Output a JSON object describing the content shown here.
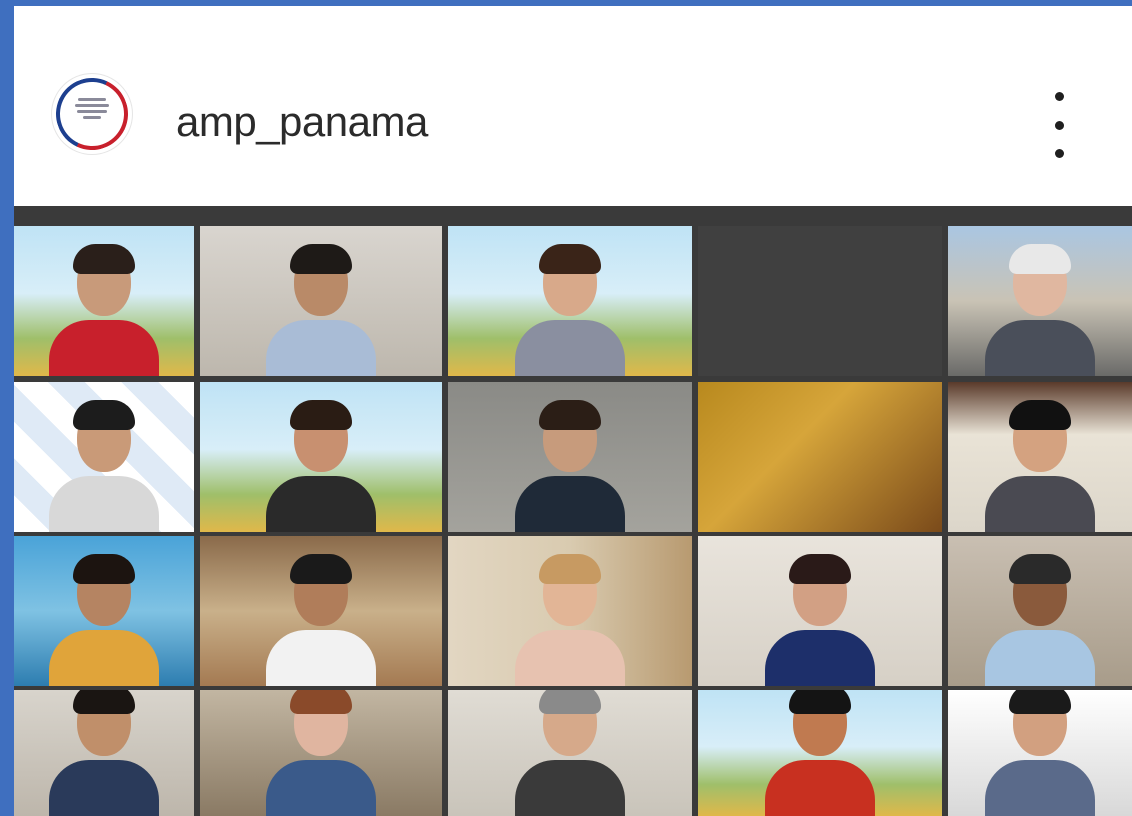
{
  "profile": {
    "username": "amp_panama",
    "avatar_icon": "amp-panama-logo-icon",
    "more_icon": "more-vertical-icon"
  },
  "colors": {
    "frame": "#3f6fbf",
    "grid_background": "#3a3a3a",
    "active_speaker_border": "#c8e04a",
    "logo_blue": "#1d3f8f",
    "logo_red": "#c8202c"
  },
  "participants": [
    {
      "label": ""
    },
    {
      "label": ""
    },
    {
      "label": ""
    },
    {
      "label": ""
    },
    {
      "label": ""
    },
    {
      "label": ""
    },
    {
      "label": ""
    },
    {
      "label": ""
    },
    {
      "label": ""
    },
    {
      "label": ""
    },
    {
      "label": ""
    },
    {
      "label": ""
    },
    {
      "label": ""
    },
    {
      "label": ""
    },
    {
      "label": ""
    },
    {
      "label": ""
    },
    {
      "label": ""
    },
    {
      "label": ""
    },
    {
      "label": ""
    },
    {
      "label": ""
    }
  ]
}
